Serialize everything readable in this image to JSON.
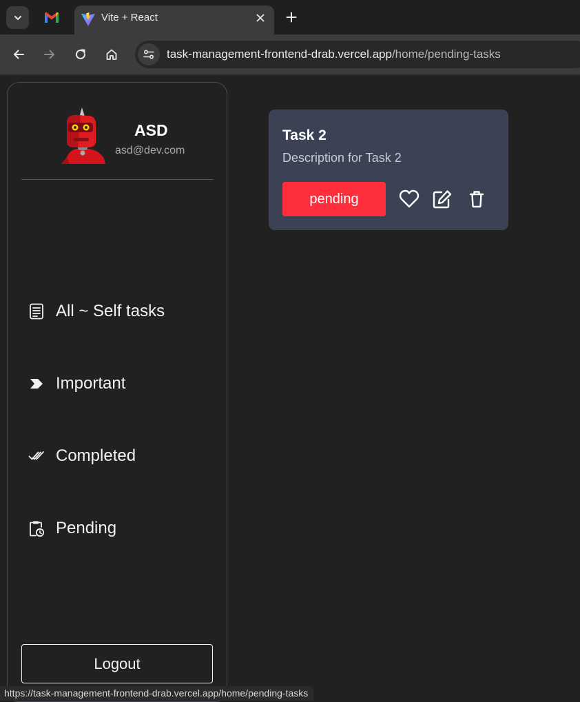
{
  "browser": {
    "tab_title": "Vite + React",
    "url_host": "task-management-frontend-drab.vercel.app",
    "url_path": "/home/pending-tasks",
    "status_url": "https://task-management-frontend-drab.vercel.app/home/pending-tasks",
    "icons": {
      "tab_search": "chevron-down-icon",
      "pinned": "gmail-icon",
      "favicon": "vite-icon",
      "close": "close-icon",
      "new_tab": "plus-icon",
      "back": "back-arrow-icon",
      "forward": "forward-arrow-icon",
      "reload": "reload-icon",
      "home": "home-icon",
      "site_info": "tune-icon"
    }
  },
  "sidebar": {
    "user": {
      "name": "ASD",
      "email": "asd@dev.com"
    },
    "items": [
      {
        "label": "All ~ Self tasks",
        "icon": "document-icon"
      },
      {
        "label": "Important",
        "icon": "label-arrow-icon"
      },
      {
        "label": "Completed",
        "icon": "double-check-icon"
      },
      {
        "label": "Pending",
        "icon": "clipboard-clock-icon"
      }
    ],
    "logout_label": "Logout"
  },
  "tasks": [
    {
      "title": "Task 2",
      "description": "Description for Task 2",
      "status": "pending"
    }
  ],
  "colors": {
    "page_bg": "#212121",
    "card_bg": "#3a4254",
    "status_pending": "#ff2e3d",
    "sidebar_border": "#4a4a55"
  }
}
